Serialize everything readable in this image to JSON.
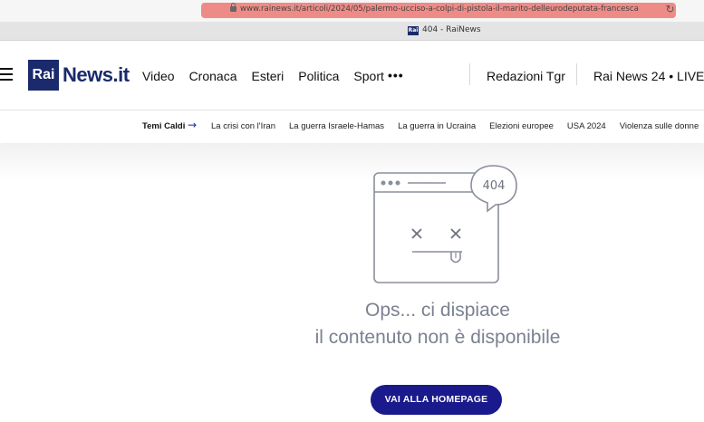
{
  "browser": {
    "url": "www.rainews.it/articoli/2024/05/palermo-ucciso-a-colpi-di-pistola-il-marito-delleurodeputata-francesca",
    "tab_title": "404 - RaiNews",
    "favicon_text": "Rai"
  },
  "header": {
    "logo_rai": "Rai",
    "logo_news": "News.it",
    "nav": [
      "Video",
      "Cronaca",
      "Esteri",
      "Politica",
      "Sport"
    ],
    "more": "•••",
    "redazioni": "Redazioni Tgr",
    "rainews24": "Rai News 24 • LIVE"
  },
  "temi": {
    "label": "Temi Caldi",
    "items": [
      "La crisi con l'Iran",
      "La guerra Israele-Hamas",
      "La guerra in Ucraina",
      "Elezioni europee",
      "USA 2024",
      "Violenza sulle donne"
    ]
  },
  "error": {
    "code": "404",
    "line1": "Ops... ci dispiace",
    "line2": "il contenuto non è disponibile",
    "button": "VAI ALLA HOMEPAGE"
  },
  "colors": {
    "brand": "#1a2a6c",
    "button": "#1a1a8c",
    "message": "#7b8190",
    "url_highlight": "#ef8b86"
  }
}
